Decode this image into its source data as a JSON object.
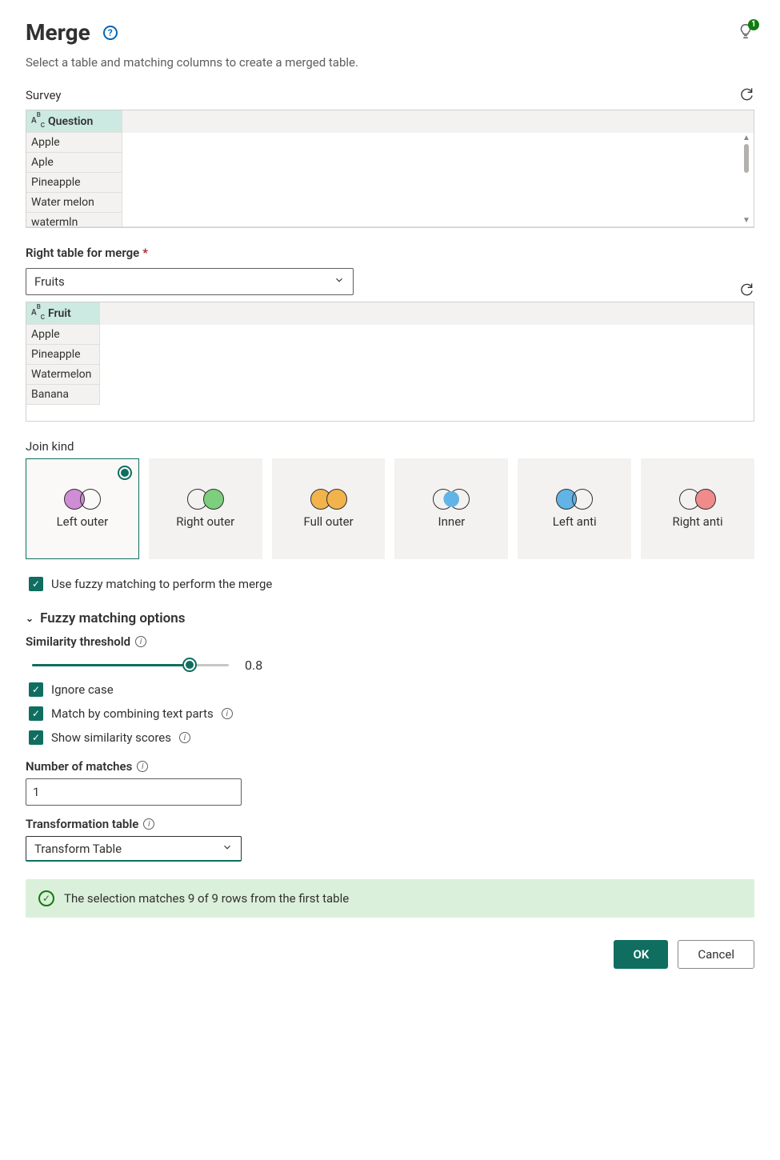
{
  "header": {
    "title": "Merge",
    "subtitle": "Select a table and matching columns to create a merged table.",
    "tips_badge": "1"
  },
  "left_table": {
    "label": "Survey",
    "column": "Question",
    "rows": [
      "Apple",
      "Aple",
      "Pineapple",
      "Water melon",
      "watermln"
    ]
  },
  "right_table": {
    "label": "Right table for merge",
    "selected": "Fruits",
    "column": "Fruit",
    "rows": [
      "Apple",
      "Pineapple",
      "Watermelon",
      "Banana"
    ]
  },
  "join": {
    "label": "Join kind",
    "options": [
      "Left outer",
      "Right outer",
      "Full outer",
      "Inner",
      "Left anti",
      "Right anti"
    ],
    "selected": "Left outer"
  },
  "fuzzy": {
    "use_label": "Use fuzzy matching to perform the merge",
    "section_title": "Fuzzy matching options",
    "threshold_label": "Similarity threshold",
    "threshold_value": "0.8",
    "ignore_case": "Ignore case",
    "combine_text": "Match by combining text parts",
    "show_scores": "Show similarity scores",
    "num_matches_label": "Number of matches",
    "num_matches_value": "1",
    "transform_label": "Transformation table",
    "transform_selected": "Transform Table"
  },
  "status": {
    "text": "The selection matches 9 of 9 rows from the first table"
  },
  "footer": {
    "ok": "OK",
    "cancel": "Cancel"
  }
}
